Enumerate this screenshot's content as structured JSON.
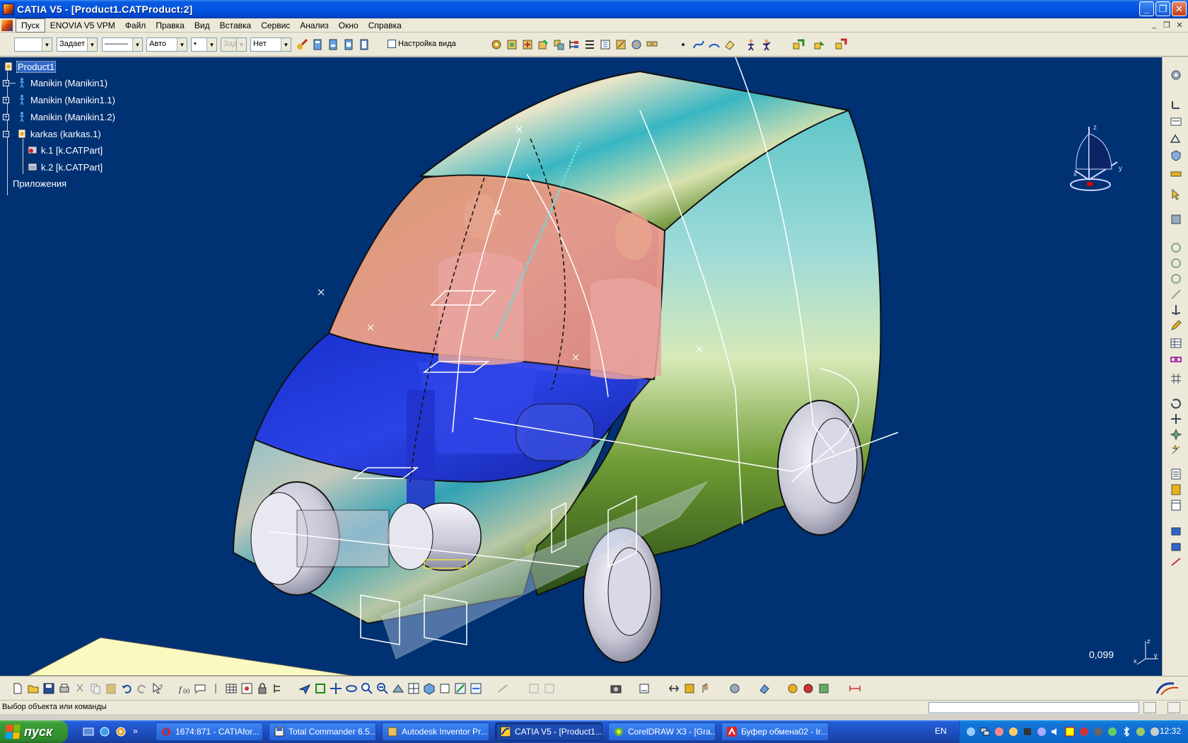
{
  "window": {
    "title": "CATIA V5 - [Product1.CATProduct:2]",
    "min_glyph": "_",
    "max_glyph": "❐",
    "close_glyph": "✕"
  },
  "menu": {
    "items": [
      "Пуск",
      "ENOVIA V5 VPM",
      "Файл",
      "Правка",
      "Вид",
      "Вставка",
      "Сервис",
      "Анализ",
      "Окно",
      "Справка"
    ]
  },
  "toolbar": {
    "combo_color": "",
    "combo_transparency": "Задает",
    "combo_linetype": "———",
    "combo_thickness": "Авто",
    "combo_point": "•",
    "combo_layer": "Зад",
    "combo_layer_filter": "Нет",
    "view_setting_label": "Настройка вида"
  },
  "tree": {
    "root": "Product1",
    "nodes": [
      "Manikin (Manikin1)",
      "Manikin (Manikin1.1)",
      "Manikin (Manikin1.2)",
      "karkas (karkas.1)",
      "k.1 [k.CATPart]",
      "k.2 [k.CATPart]",
      "Приложения"
    ]
  },
  "viewport": {
    "zoom_value": "0,099",
    "compass_x": "x",
    "compass_y": "y",
    "compass_z": "z",
    "background_color": "#003173"
  },
  "status": {
    "text": "Выбор объекта или команды"
  },
  "taskbar": {
    "start_label": "пуск",
    "tasks": [
      "1674:871 - CATIAfor...",
      "Total Commander 6.5...",
      "Autodesk Inventor Pr...",
      "CATIA V5 - [Product1...",
      "CorelDRAW X3 - [Gra...",
      "Буфер обмена02 - Ir..."
    ],
    "lang": "EN",
    "clock": "12:32"
  },
  "colors": {
    "title_blue": "#0054e3",
    "viewport_blue": "#003173",
    "xp_green": "#3c9f38"
  }
}
